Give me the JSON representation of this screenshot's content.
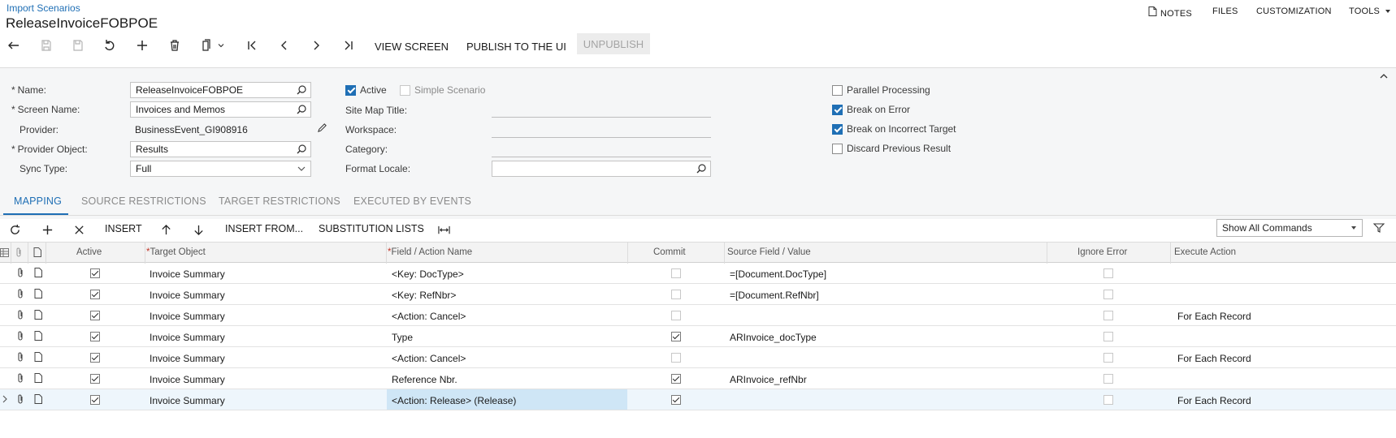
{
  "header": {
    "breadcrumb": "Import Scenarios",
    "title": "ReleaseInvoiceFOBPOE",
    "links": {
      "notes": "NOTES",
      "files": "FILES",
      "customization": "CUSTOMIZATION",
      "tools": "TOOLS"
    }
  },
  "toolbar": {
    "view_screen": "VIEW SCREEN",
    "publish": "PUBLISH TO THE UI",
    "unpublish": "UNPUBLISH"
  },
  "form": {
    "name_label": "Name:",
    "name_value": "ReleaseInvoiceFOBPOE",
    "screen_name_label": "Screen Name:",
    "screen_name_value": "Invoices and Memos",
    "provider_label": "Provider:",
    "provider_value": "BusinessEvent_GI908916",
    "provider_object_label": "Provider Object:",
    "provider_object_value": "Results",
    "sync_type_label": "Sync Type:",
    "sync_type_value": "Full",
    "active_label": "Active",
    "active_checked": true,
    "simple_scenario_label": "Simple Scenario",
    "simple_scenario_checked": false,
    "site_map_title_label": "Site Map Title:",
    "workspace_label": "Workspace:",
    "category_label": "Category:",
    "format_locale_label": "Format Locale:",
    "format_locale_value": "",
    "parallel_processing_label": "Parallel Processing",
    "break_on_error_label": "Break on Error",
    "break_on_incorrect_target_label": "Break on Incorrect Target",
    "discard_previous_result_label": "Discard Previous Result"
  },
  "tabs": [
    "MAPPING",
    "SOURCE RESTRICTIONS",
    "TARGET RESTRICTIONS",
    "EXECUTED BY EVENTS"
  ],
  "grid_toolbar": {
    "insert": "INSERT",
    "insert_from": "INSERT FROM...",
    "substitution_lists": "SUBSTITUTION LISTS",
    "commands_select": "Show All Commands"
  },
  "grid": {
    "columns": {
      "active": "Active",
      "target_object": "Target Object",
      "field_action": "Field / Action Name",
      "commit": "Commit",
      "source_field": "Source Field / Value",
      "ignore_error": "Ignore Error",
      "execute_action": "Execute Action"
    },
    "rows": [
      {
        "active": true,
        "target": "Invoice Summary",
        "field": "<Key: DocType>",
        "commit": false,
        "commit_disabled": true,
        "source": "=[Document.DocType]",
        "ignore": false,
        "execute": ""
      },
      {
        "active": true,
        "target": "Invoice Summary",
        "field": "<Key: RefNbr>",
        "commit": false,
        "commit_disabled": true,
        "source": "=[Document.RefNbr]",
        "ignore": false,
        "execute": ""
      },
      {
        "active": true,
        "target": "Invoice Summary",
        "field": "<Action: Cancel>",
        "commit": false,
        "commit_disabled": true,
        "source": "",
        "ignore": false,
        "execute": "For Each Record"
      },
      {
        "active": true,
        "target": "Invoice Summary",
        "field": "Type",
        "commit": true,
        "commit_disabled": false,
        "source": "ARInvoice_docType",
        "ignore": false,
        "execute": ""
      },
      {
        "active": true,
        "target": "Invoice Summary",
        "field": "<Action: Cancel>",
        "commit": false,
        "commit_disabled": true,
        "source": "",
        "ignore": false,
        "execute": "For Each Record"
      },
      {
        "active": true,
        "target": "Invoice Summary",
        "field": "Reference Nbr.",
        "commit": true,
        "commit_disabled": false,
        "source": "ARInvoice_refNbr",
        "ignore": false,
        "execute": ""
      },
      {
        "active": true,
        "target": "Invoice Summary",
        "field": "<Action: Release> (Release)",
        "commit": true,
        "commit_disabled": false,
        "source": "",
        "ignore": false,
        "execute": "For Each Record"
      }
    ]
  },
  "colors": {
    "accent": "#1f6fb5",
    "form_bg": "#f5f6f7",
    "selected_cell": "#cfe6f6"
  }
}
